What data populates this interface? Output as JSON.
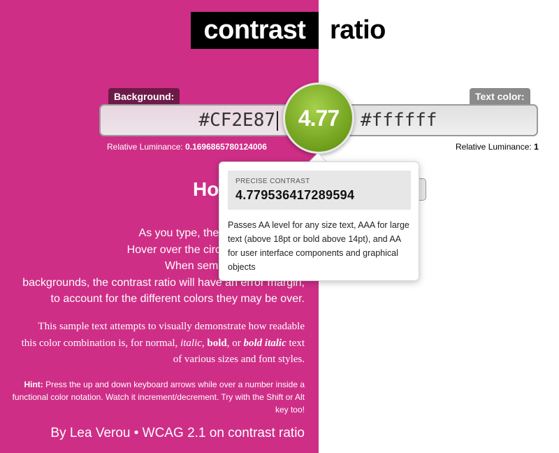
{
  "colors": {
    "background_color": "#cf2e87",
    "text_color": "#ffffff",
    "ratio_badge": "#7bab22"
  },
  "header": {
    "title_part_1": "contrast",
    "title_part_2": "ratio"
  },
  "background": {
    "label": "Background:",
    "value": "#CF2E87",
    "luminance_label": "Relative Luminance:",
    "luminance_value": "0.1696865780124006"
  },
  "foreground": {
    "label": "Text color:",
    "value": "#ffffff",
    "luminance_label": "Relative Luminance:",
    "luminance_value": "1"
  },
  "ratio": {
    "value": "4.77"
  },
  "popover": {
    "precise_label": "PRECISE CONTRAST",
    "precise_value": "4.779536417289594",
    "description": "Passes AA level for any size text, AAA for large text (above 18pt or bold above 14pt), and AA for user interface components and graphical objects"
  },
  "main": {
    "heading_visible": "Ho",
    "para_lines": [
      "As you type, the contrast ratio ind",
      "Hover over the circle to get more de",
      "When semi-transparent colo",
      "backgrounds, the contrast ratio will have an error margin,",
      "to account for the different colors they may be over."
    ],
    "sample": {
      "line1": "This sample text attempts to visually demonstrate how readable",
      "line2_pre": "this color combination is, for normal, ",
      "italic": "italic",
      "sep1": ", ",
      "bold": "bold",
      "sep2": ", or ",
      "bold_italic": "bold italic",
      "line2_post": " text",
      "line3": "of various sizes and font styles."
    },
    "hint": {
      "label": "Hint:",
      "text": " Press the up and down keyboard arrows while over a number inside a functional color notation. Watch it increment/decrement. Try with the Shift or Alt key too!"
    },
    "byline": "By Lea Verou • WCAG 2.1 on contrast ratio"
  }
}
